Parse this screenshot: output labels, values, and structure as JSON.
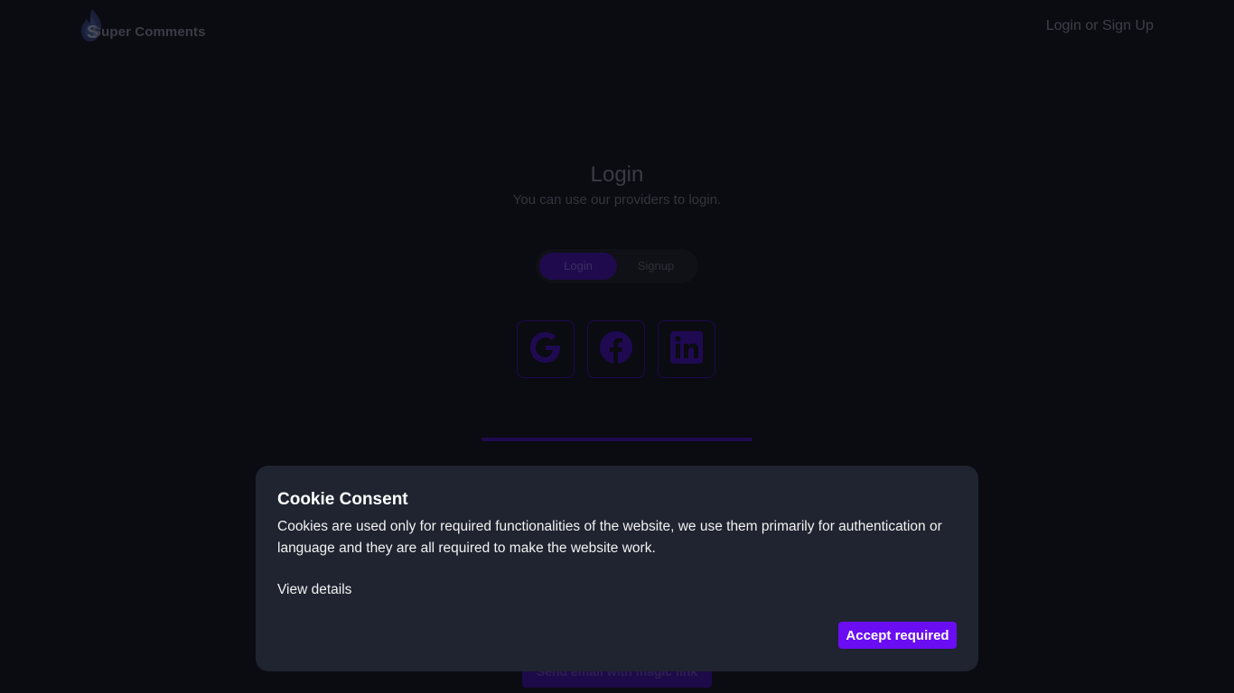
{
  "header": {
    "logo_text": "Super Comments",
    "logo_icon": "flame-s-logo-icon",
    "nav_login_label": "Login or Sign Up"
  },
  "main": {
    "title": "Login",
    "subtitle": "You can use our providers to login.",
    "tabs": [
      {
        "label": "Login",
        "active": true
      },
      {
        "label": "Signup",
        "active": false
      }
    ],
    "providers": [
      {
        "name": "Google",
        "icon": "google-icon"
      },
      {
        "name": "Facebook",
        "icon": "facebook-icon"
      },
      {
        "name": "LinkedIn",
        "icon": "linkedin-icon"
      }
    ],
    "magic_link_label": "Send email with magic link"
  },
  "cookie_consent": {
    "title": "Cookie Consent",
    "body": "Cookies are used only for required functionalities of the website, we use them primarily for authentication or language and they are all required to make the website work.",
    "details_label": "View details",
    "accept_label": "Accept required"
  },
  "colors": {
    "accent": "#6a0df2",
    "background": "#0b0b12",
    "dialog_background": "#1f2430",
    "dimmed_accent": "#1d0a4d"
  }
}
